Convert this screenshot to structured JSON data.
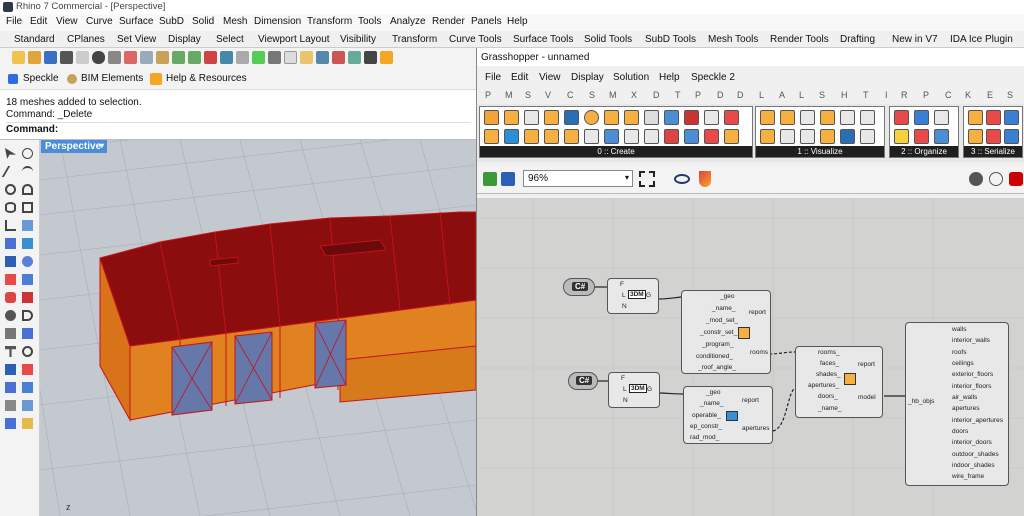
{
  "window": {
    "title": "Rhino 7 Commercial - [Perspective]"
  },
  "menu": [
    "File",
    "Edit",
    "View",
    "Curve",
    "Surface",
    "SubD",
    "Solid",
    "Mesh",
    "Dimension",
    "Transform",
    "Tools",
    "Analyze",
    "Render",
    "Panels",
    "Help"
  ],
  "toolbar_tabs": [
    "Standard",
    "CPlanes",
    "Set View",
    "Display",
    "Select",
    "Viewport Layout",
    "Visibility",
    "Transform",
    "Curve Tools",
    "Surface Tools",
    "Solid Tools",
    "SubD Tools",
    "Mesh Tools",
    "Render Tools",
    "Drafting",
    "New in V7",
    "IDA Ice Plugin"
  ],
  "plugins": {
    "speckle": "Speckle",
    "bim": "BIM Elements",
    "help": "Help & Resources"
  },
  "command": {
    "history1": "18 meshes added to selection.",
    "history2": "Command: _Delete",
    "prompt": "Command:"
  },
  "viewport": {
    "label": "Perspective",
    "axis": "z"
  },
  "grasshopper": {
    "title": "Grasshopper - unnamed",
    "menu": [
      "File",
      "Edit",
      "View",
      "Display",
      "Solution",
      "Help",
      "Speckle 2"
    ],
    "tab_letters": [
      "P",
      "M",
      "S",
      "V",
      "C",
      "S",
      "M",
      "X",
      "D",
      "T",
      "P",
      "D",
      "D",
      "L",
      "A",
      "L",
      "S",
      "H",
      "T",
      "I",
      "R",
      "P",
      "C",
      "K",
      "E",
      "S"
    ],
    "ribbon_panels": [
      "0 :: Create",
      "1 :: Visualize",
      "2 :: Organize",
      "3 :: Serialize"
    ],
    "zoom": "96%",
    "components": {
      "code1": {
        "label": "C#"
      },
      "code2": {
        "label": "C#"
      },
      "model3d_1": {
        "inputs": [
          "F",
          "L",
          "N"
        ],
        "output": "G",
        "label": "3DM"
      },
      "model3d_2": {
        "inputs": [
          "F",
          "L",
          "N"
        ],
        "output": "G",
        "label": "3DM"
      },
      "room": {
        "inputs": [
          "_geo",
          "_name_",
          "_mod_set_",
          "_constr_set_",
          "_program_",
          "conditioned_",
          "_roof_angle_"
        ],
        "outputs": [
          "report",
          "rooms"
        ]
      },
      "aperture": {
        "inputs": [
          "_geo",
          "_name_",
          "operable_",
          "ep_constr_",
          "rad_mod_"
        ],
        "outputs": [
          "report",
          "apertures"
        ]
      },
      "model": {
        "inputs": [
          "rooms_",
          "faces_",
          "shades_",
          "apertures_",
          "doors_",
          "_name_"
        ],
        "outputs": [
          "report",
          "model"
        ]
      },
      "deconstruct": {
        "input": "_hb_objs",
        "outputs": [
          "walls",
          "interior_walls",
          "roofs",
          "ceilings",
          "exterior_floors",
          "interior_floors",
          "air_walls",
          "apertures",
          "interior_apertures",
          "doors",
          "interior_doors",
          "outdoor_shades",
          "indoor_shades",
          "wire_frame"
        ]
      }
    }
  },
  "colors": {
    "roof": "#8b0d0d",
    "wall": "#e0821f",
    "window": "#6677aa",
    "viewport_tab": "#4a8ddb"
  }
}
